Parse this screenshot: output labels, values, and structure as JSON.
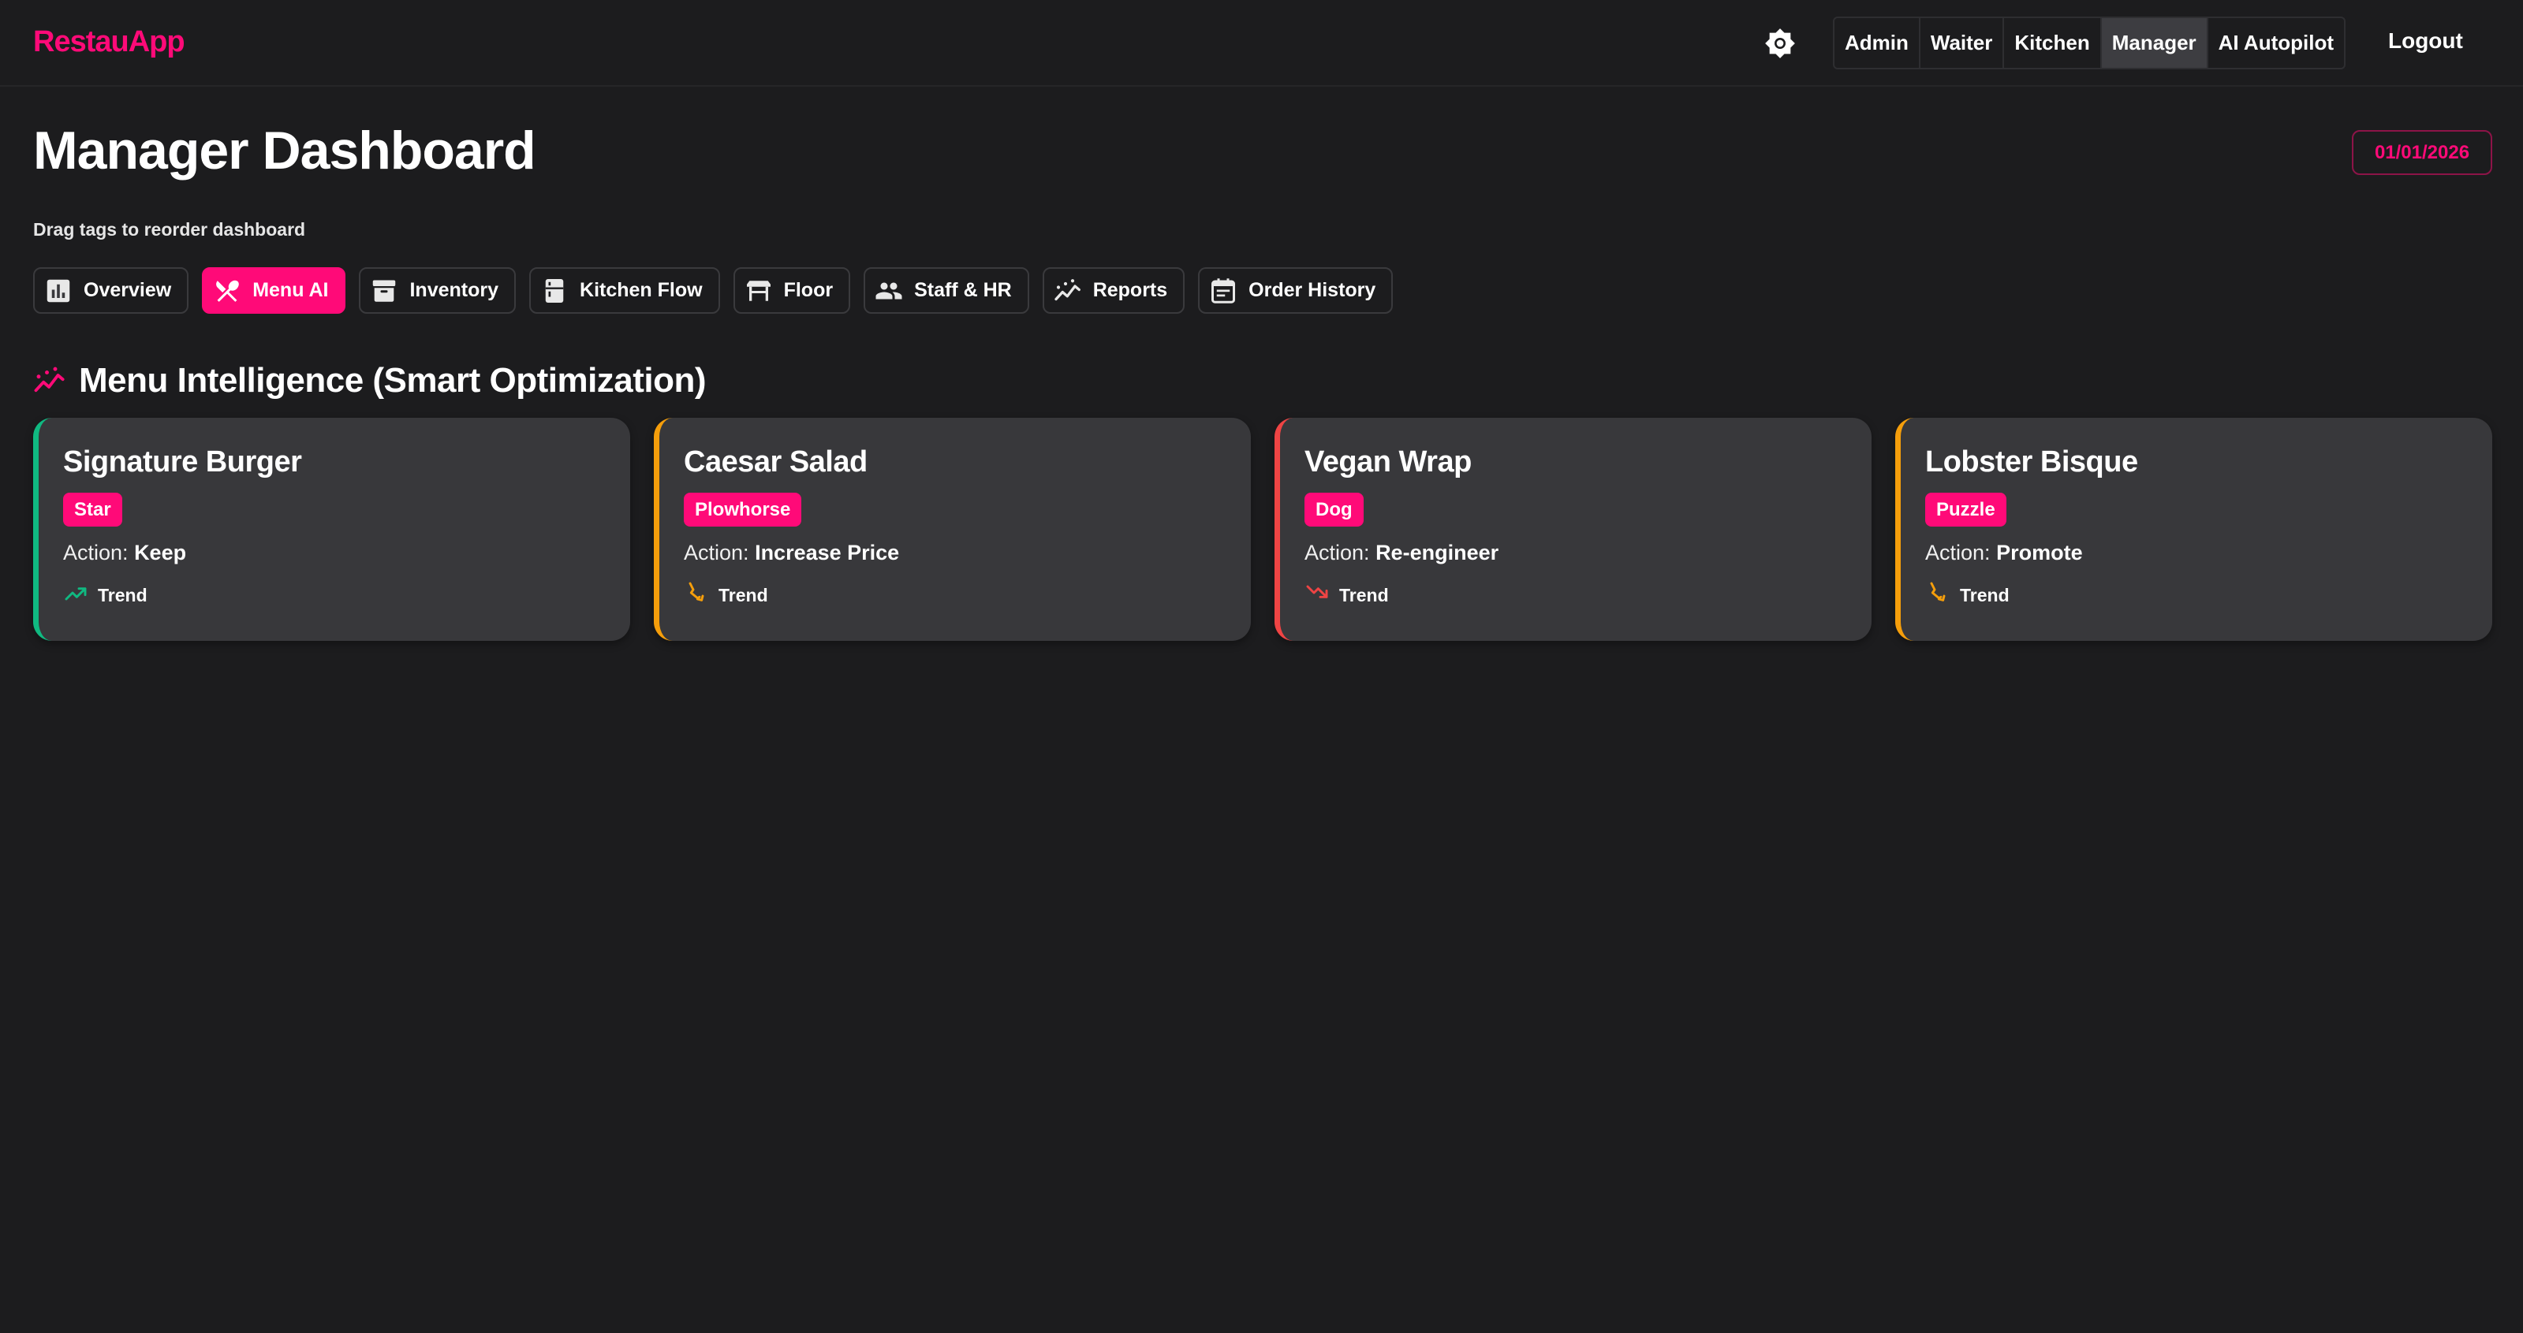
{
  "app": {
    "brand": "RestauApp",
    "brand_color": "#ff0a78"
  },
  "header": {
    "roles": [
      "Admin",
      "Waiter",
      "Kitchen",
      "Manager",
      "AI Autopilot"
    ],
    "active_role": "Manager",
    "logout_label": "Logout",
    "theme_icon": "brightness-icon"
  },
  "page": {
    "title": "Manager Dashboard",
    "date": "01/01/2026",
    "hint": "Drag tags to reorder dashboard"
  },
  "tabs": [
    {
      "label": "Overview",
      "icon": "bar-chart-icon"
    },
    {
      "label": "Menu AI",
      "icon": "utensils-icon",
      "active": true
    },
    {
      "label": "Inventory",
      "icon": "archive-box-icon"
    },
    {
      "label": "Kitchen Flow",
      "icon": "fridge-icon"
    },
    {
      "label": "Floor",
      "icon": "table-icon"
    },
    {
      "label": "Staff & HR",
      "icon": "people-icon"
    },
    {
      "label": "Reports",
      "icon": "trending-icon"
    },
    {
      "label": "Order History",
      "icon": "calendar-icon"
    }
  ],
  "section": {
    "title": "Menu Intelligence (Smart Optimization)",
    "icon": "trending-icon"
  },
  "menu_items": [
    {
      "name": "Signature Burger",
      "category": "Star",
      "action_label": "Action:",
      "action": "Keep",
      "trend_label": "Trend",
      "trend": "up",
      "accent": "#10b981",
      "trend_color": "#10b981"
    },
    {
      "name": "Caesar Salad",
      "category": "Plowhorse",
      "action_label": "Action:",
      "action": "Increase Price",
      "trend_label": "Trend",
      "trend": "flat",
      "accent": "#f59e0b",
      "trend_color": "#f59e0b"
    },
    {
      "name": "Vegan Wrap",
      "category": "Dog",
      "action_label": "Action:",
      "action": "Re-engineer",
      "trend_label": "Trend",
      "trend": "down",
      "accent": "#ef4444",
      "trend_color": "#ef4444"
    },
    {
      "name": "Lobster Bisque",
      "category": "Puzzle",
      "action_label": "Action:",
      "action": "Promote",
      "trend_label": "Trend",
      "trend": "flat",
      "accent": "#f59e0b",
      "trend_color": "#f59e0b"
    }
  ]
}
